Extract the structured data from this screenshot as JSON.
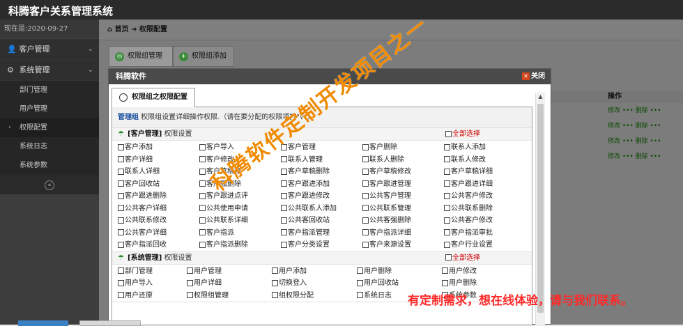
{
  "app": {
    "title": "科腾客户关系管理系统"
  },
  "sidebar": {
    "now": "现在是:2020-09-27 14:16:39",
    "groups": [
      {
        "label": "客户管理"
      },
      {
        "label": "系统管理"
      }
    ],
    "items": [
      {
        "label": "部门管理"
      },
      {
        "label": "用户管理"
      },
      {
        "label": "权限配置"
      },
      {
        "label": "系统日志"
      },
      {
        "label": "系统参数"
      }
    ]
  },
  "breadcrumb": {
    "home": "首页",
    "sep": "➔",
    "current": "权限配置"
  },
  "tabs": [
    {
      "label": "权限组管理"
    },
    {
      "label": "权限组添加"
    }
  ],
  "bgtable": {
    "header": "操作",
    "row_text": "修改 ••• 删除 •••"
  },
  "dialog": {
    "title": "科腾软件",
    "close": "关闭",
    "tab": "权限组之权限配置",
    "intro_kw": "管理组",
    "intro_text": "权限组设置详细操作权限.（请在要分配的权限项打\"√\"）",
    "sections": [
      {
        "name": "[客户管理]",
        "suffix": "权限设置",
        "selall": "全部选择",
        "items": [
          "客户添加",
          "客户导入",
          "客户管理",
          "客户删除",
          "联系人添加",
          "客户详细",
          "客户修改",
          "联系人管理",
          "联系人删除",
          "联系人修改",
          "联系人详细",
          "客户草稿箱",
          "客户草稿删除",
          "客户草稿修改",
          "客户草稿详细",
          "客户回收站",
          "客户强删除",
          "客户跟进添加",
          "客户跟进管理",
          "客户跟进详细",
          "客户跟进删除",
          "客户跟进点评",
          "客户跟进修改",
          "公共客户管理",
          "公共客户修改",
          "公共客户详细",
          "公共使用申请",
          "公共联系人添加",
          "公共联系管理",
          "公共联系删除",
          "公共联系修改",
          "公共联系详细",
          "公共客回收站",
          "公共客强删除",
          "公共客户修改",
          "公共客户详细",
          "客户指派",
          "客户指派管理",
          "客户指派详细",
          "客户指派审批",
          "客户指派回收",
          "客户指派删除",
          "客户分类设置",
          "客户来源设置",
          "客户行业设置"
        ]
      },
      {
        "name": "[系统管理]",
        "suffix": "权限设置",
        "selall": "全部选择",
        "items": [
          "部门管理",
          "用户管理",
          "用户添加",
          "用户删除",
          "用户修改",
          "用户导入",
          "用户详细",
          "切换登入",
          "用户回收站",
          "用户删除",
          "用户还原",
          "权限组管理",
          "组权限分配",
          "系统日志",
          "系统参数"
        ]
      }
    ]
  },
  "overlay": {
    "watermark": "科腾软件定制开发项目之一",
    "promo": "有定制需求，想在线体验，请与我们联系。"
  },
  "colors": {
    "topbar": "#2b2b2b",
    "sidebar": "#2a2a2a",
    "overlay_bg": "#7c7c7c",
    "link_blue": "#1a4fa0",
    "red": "#cc0000",
    "watermark": "#f08a00",
    "promo": "#ff2a2a"
  }
}
